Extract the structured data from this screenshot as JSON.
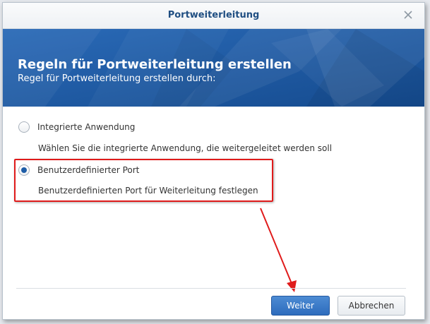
{
  "dialog": {
    "title": "Portweiterleitung",
    "close_icon": "close-icon"
  },
  "banner": {
    "title": "Regeln für Portweiterleitung erstellen",
    "subtitle": "Regel für Portweiterleitung erstellen durch:",
    "color": "#1d5aa3"
  },
  "options": [
    {
      "label": "Integrierte Anwendung",
      "description": "Wählen Sie die integrierte Anwendung, die weitergeleitet werden soll",
      "selected": false
    },
    {
      "label": "Benutzerdefinierter Port",
      "description": "Benutzerdefinierten Port für Weiterleitung festlegen",
      "selected": true
    }
  ],
  "annotation": {
    "highlight_color": "#e01b1b"
  },
  "footer": {
    "next_label": "Weiter",
    "cancel_label": "Abbrechen"
  }
}
